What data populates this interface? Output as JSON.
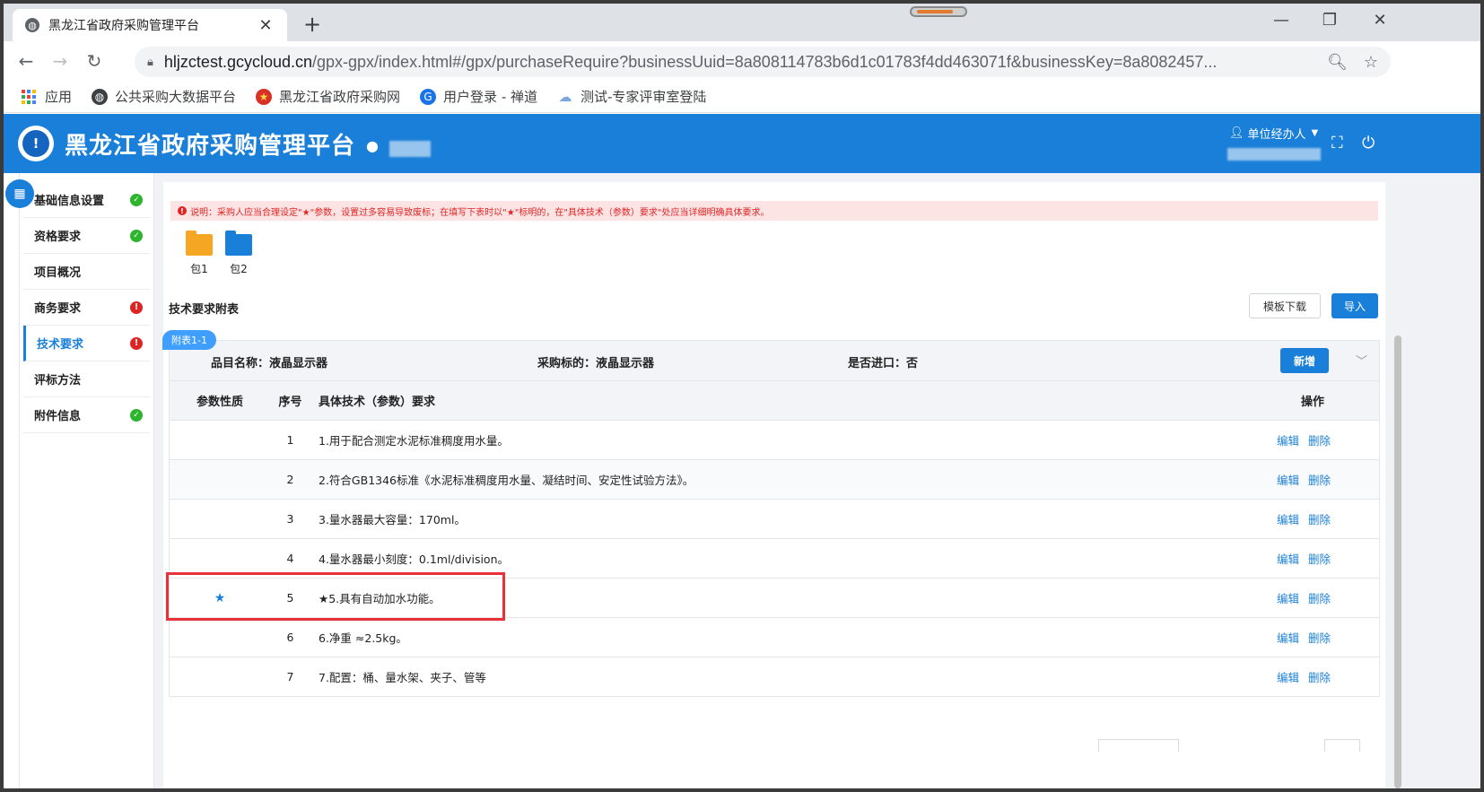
{
  "browser": {
    "tab_title": "黑龙江省政府采购管理平台",
    "tab_close": "✕",
    "new_tab": "+",
    "url_host": "hljzctest.gcycloud.cn",
    "url_path": "/gpx-gpx/index.html#/gpx/purchaseRequire?businessUuid=8a808114783b6d1c01783f4dd463071f&businessKey=8a8082457...",
    "bookmarks": [
      {
        "label": "应用",
        "icon": "apps-grid-icon"
      },
      {
        "label": "公共采购大数据平台",
        "icon": "globe-icon"
      },
      {
        "label": "黑龙江省政府采购网",
        "icon": "emblem-icon"
      },
      {
        "label": "用户登录 - 禅道",
        "icon": "zentao-icon"
      },
      {
        "label": "测试-专家评审室登陆",
        "icon": "cloud-icon"
      }
    ]
  },
  "header": {
    "title": "黑龙江省政府采购管理平台",
    "user_role": "单位经办人"
  },
  "sidebar": {
    "items": [
      {
        "label": "基础信息设置",
        "status": "ok"
      },
      {
        "label": "资格要求",
        "status": "ok"
      },
      {
        "label": "项目概况",
        "status": "none"
      },
      {
        "label": "商务要求",
        "status": "error"
      },
      {
        "label": "技术要求",
        "status": "error",
        "active": true
      },
      {
        "label": "评标方法",
        "status": "none"
      },
      {
        "label": "附件信息",
        "status": "ok"
      }
    ]
  },
  "main": {
    "notice": "说明：采购人应当合理设定\"★\"参数，设置过多容易导致废标；在填写下表时以\"★\"标明的，在\"具体技术（参数）要求\"处应当详细明确具体要求。",
    "packages": [
      {
        "label": "包1",
        "color": "#f5a623"
      },
      {
        "label": "包2",
        "color": "#1a7fd8"
      }
    ],
    "section_title": "技术要求附表",
    "template_download": "模板下载",
    "import": "导入",
    "table_tag": "附表1-1",
    "item_name": "品目名称：液晶显示器",
    "purchase_target": "采购标的：液晶显示器",
    "is_import": "是否进口：否",
    "add_button": "新增",
    "columns": {
      "nature": "参数性质",
      "seq": "序号",
      "requirement": "具体技术（参数）要求",
      "operation": "操作"
    },
    "edit_label": "编辑",
    "delete_label": "删除",
    "rows": [
      {
        "star": "",
        "seq": "1",
        "text": "1.用于配合测定水泥标准稠度用水量。"
      },
      {
        "star": "",
        "seq": "2",
        "text": "2.符合GB1346标准《水泥标准稠度用水量、凝结时间、安定性试验方法》。"
      },
      {
        "star": "",
        "seq": "3",
        "text": "3.量水器最大容量：170ml。"
      },
      {
        "star": "",
        "seq": "4",
        "text": "4.量水器最小刻度：0.1ml/division。"
      },
      {
        "star": "★",
        "seq": "5",
        "text": "★5.具有自动加水功能。"
      },
      {
        "star": "",
        "seq": "6",
        "text": "6.净重 ≈2.5kg。"
      },
      {
        "star": "",
        "seq": "7",
        "text": "7.配置：桶、量水架、夹子、管等"
      }
    ]
  },
  "colors": {
    "primary": "#1a7fd8",
    "ok": "#2db52d",
    "error": "#e02424",
    "highlight": "#e8313b"
  }
}
